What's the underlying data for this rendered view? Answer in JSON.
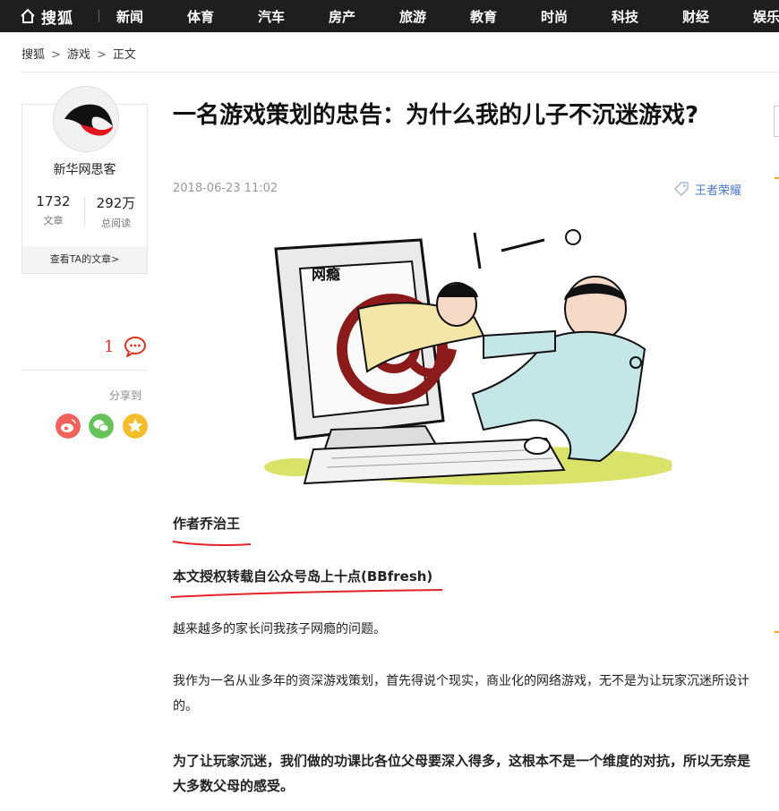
{
  "nav": {
    "logo_text": "搜狐",
    "items": [
      "新闻",
      "体育",
      "汽车",
      "房产",
      "旅游",
      "教育",
      "时尚",
      "科技",
      "财经",
      "娱乐"
    ]
  },
  "breadcrumb": {
    "items": [
      "搜狐",
      "游戏",
      "正文"
    ],
    "separator": ">"
  },
  "author": {
    "name": "新华网思客",
    "articles_count": "1732",
    "articles_label": "文章",
    "reads_count": "292万",
    "reads_label": "总阅读",
    "link_label": "查看TA的文章>"
  },
  "comments": {
    "count": "1"
  },
  "share": {
    "label": "分享到",
    "targets": [
      "weibo-icon",
      "wechat-icon",
      "favorite-star-icon"
    ],
    "colors": {
      "weibo": "#f0625a",
      "wechat": "#65c35a",
      "favorite": "#f5bd2c"
    }
  },
  "article": {
    "title": "一名游戏策划的忠告：为什么我的儿子不沉迷游戏?",
    "date": "2018-06-23 11:02",
    "tag": "王者荣耀",
    "illustration_text": "网瘾",
    "paragraphs": [
      "作者乔治王",
      "本文授权转载自公众号岛上十点(BBfresh)",
      "越来越多的家长问我孩子网瘾的问题。",
      "我作为一名从业多年的资深游戏策划，首先得说个现实，商业化的网络游戏，无不是为让玩家沉迷所设计的。",
      "为了让玩家沉迷，我们做的功课比各位父母要深入得多，这根本不是一个维度的对抗，所以无奈是大多数父母的感受。"
    ]
  },
  "colors": {
    "nav_bg": "#1e1e1e",
    "accent_red": "#dd3322",
    "link_blue": "#4d7ac6",
    "underline_red": "#e0242a"
  }
}
